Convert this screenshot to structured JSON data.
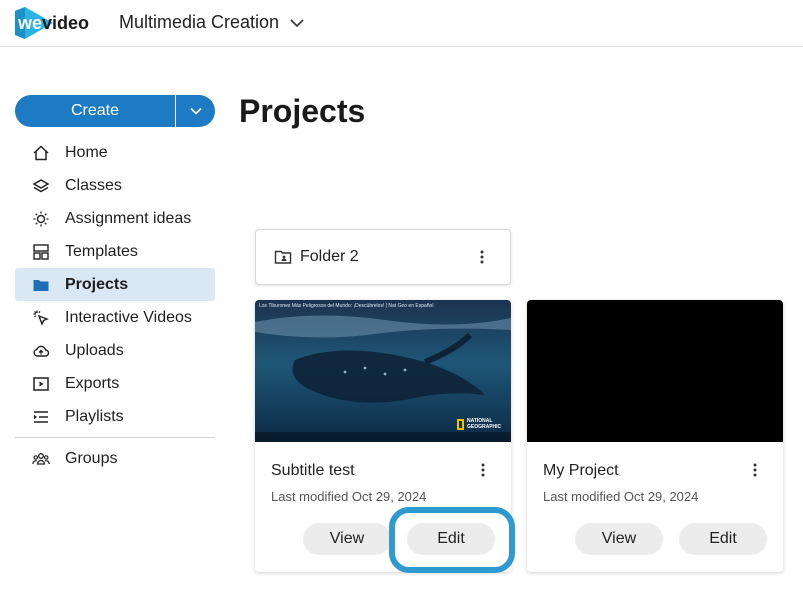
{
  "app": {
    "logo_text": "wevideo",
    "workspace_name": "Multimedia Creation"
  },
  "sidebar": {
    "create_label": "Create",
    "items": [
      {
        "label": "Home",
        "icon": "home-icon"
      },
      {
        "label": "Classes",
        "icon": "layers-icon"
      },
      {
        "label": "Assignment ideas",
        "icon": "lightbulb-icon"
      },
      {
        "label": "Templates",
        "icon": "templates-icon"
      },
      {
        "label": "Projects",
        "icon": "folder-icon",
        "active": true
      },
      {
        "label": "Interactive Videos",
        "icon": "cursor-click-icon"
      },
      {
        "label": "Uploads",
        "icon": "cloud-upload-icon"
      },
      {
        "label": "Exports",
        "icon": "play-square-icon"
      },
      {
        "label": "Playlists",
        "icon": "playlist-icon"
      },
      {
        "label": "Groups",
        "icon": "groups-icon"
      }
    ]
  },
  "main": {
    "title": "Projects",
    "folders": [
      {
        "name": "Folder 2"
      }
    ],
    "projects": [
      {
        "name": "Subtitle test",
        "modified": "Last modified Oct 29, 2024",
        "view_label": "View",
        "edit_label": "Edit",
        "thumb_title": "Los Tiburones Más Peligrosos del Mundo: ¡Descúbrelos! | Nat Geo en Español",
        "thumb_badge": "NATIONAL GEOGRAPHIC"
      },
      {
        "name": "My Project",
        "modified": "Last modified Oct 29, 2024",
        "view_label": "View",
        "edit_label": "Edit"
      }
    ]
  },
  "colors": {
    "accent": "#1d7bc4",
    "active_nav_bg": "#d9e8f4",
    "highlight_ring": "#2f9ad0",
    "button_bg": "#ececec"
  }
}
